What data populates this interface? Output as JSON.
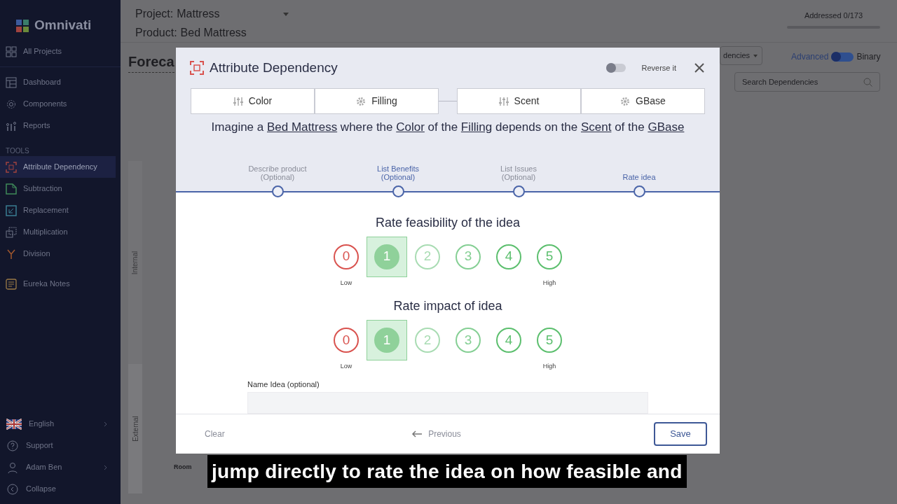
{
  "sidebar": {
    "logo": "Omnivati",
    "groups": [
      {
        "items": [
          {
            "label": "All Projects",
            "selected": false
          }
        ]
      },
      {
        "items": [
          {
            "label": "Dashboard",
            "selected": false
          },
          {
            "label": "Components",
            "selected": false
          },
          {
            "label": "Reports",
            "selected": false
          }
        ]
      },
      {
        "heading": "TOOLS",
        "items": [
          {
            "label": "Attribute Dependency",
            "selected": true
          },
          {
            "label": "Subtraction",
            "selected": false
          },
          {
            "label": "Replacement",
            "selected": false
          },
          {
            "label": "Multiplication",
            "selected": false
          },
          {
            "label": "Division",
            "selected": false
          }
        ]
      },
      {
        "items": [
          {
            "label": "Eureka Notes",
            "selected": false
          }
        ]
      }
    ],
    "bottom_items": [
      {
        "label": "English",
        "has_submenu": true
      },
      {
        "label": "Support",
        "has_submenu": false
      },
      {
        "label": "Adam Ben",
        "has_submenu": true
      },
      {
        "label": "Collapse",
        "has_submenu": false
      }
    ]
  },
  "header": {
    "project_label": "Project:",
    "project": "Mattress",
    "product_label": "Product:",
    "product": "Bed Mattress",
    "progress": {
      "label": "Addressed 0/173",
      "level": 0
    }
  },
  "page": {
    "title": "Foreca",
    "filter_dropdown": "dencies",
    "mode_toggle": {
      "left_label": "Advanced",
      "right_label": "Binary",
      "on": false
    },
    "search": {
      "placeholder": "Search Dependencies"
    },
    "side_labels": [
      "Internal",
      "External"
    ],
    "row_label": "Room"
  },
  "modal": {
    "title": "Attribute Dependency",
    "reverse_toggle": {
      "label": "Reverse it",
      "on": false
    },
    "attributes": [
      {
        "label": "Color",
        "kind": "attribute"
      },
      {
        "label": "Filling",
        "kind": "component"
      },
      {
        "label": "Scent",
        "kind": "attribute"
      },
      {
        "label": "GBase",
        "kind": "component"
      }
    ],
    "sentence": [
      {
        "text": "Imagine a ",
        "link": false
      },
      {
        "text": "Bed Mattress",
        "link": true
      },
      {
        "text": " where the ",
        "link": false
      },
      {
        "text": "Color",
        "link": true
      },
      {
        "text": " of the ",
        "link": false
      },
      {
        "text": "Filling",
        "link": true
      },
      {
        "text": " depends on the ",
        "link": false
      },
      {
        "text": "Scent",
        "link": true
      },
      {
        "text": " of the ",
        "link": false
      },
      {
        "text": "GBase",
        "link": true
      }
    ],
    "steps": [
      {
        "label": "Describe product",
        "sublabel": "(Optional)",
        "highlighted": false
      },
      {
        "label": "List Benefits",
        "sublabel": "(Optional)",
        "highlighted": true
      },
      {
        "label": "List Issues",
        "sublabel": "(Optional)",
        "highlighted": false
      },
      {
        "label": "Rate idea",
        "highlighted": true
      }
    ],
    "ratings": [
      {
        "title": "Rate feasibility of the idea",
        "low_label": "Low",
        "high_label": "High",
        "options": [
          {
            "label": "0",
            "color": "#d9534f",
            "selected": false
          },
          {
            "label": "1",
            "color": "#8fd19a",
            "selected": true
          },
          {
            "label": "2",
            "color": "#a9dcb3",
            "selected": false
          },
          {
            "label": "3",
            "color": "#85cf94",
            "selected": false
          },
          {
            "label": "4",
            "color": "#5cbf6e",
            "selected": false
          },
          {
            "label": "5",
            "color": "#5cbf6e",
            "selected": false
          }
        ]
      },
      {
        "title": "Rate impact of idea",
        "low_label": "Low",
        "high_label": "High",
        "options": [
          {
            "label": "0",
            "color": "#d9534f",
            "selected": false
          },
          {
            "label": "1",
            "color": "#8fd19a",
            "selected": true
          },
          {
            "label": "2",
            "color": "#a9dcb3",
            "selected": false
          },
          {
            "label": "3",
            "color": "#85cf94",
            "selected": false
          },
          {
            "label": "4",
            "color": "#5cbf6e",
            "selected": false
          },
          {
            "label": "5",
            "color": "#5cbf6e",
            "selected": false
          }
        ]
      }
    ],
    "name_field": {
      "label": "Name Idea (optional)"
    },
    "footer": {
      "clear": "Clear",
      "previous": "Previous",
      "save": "Save"
    }
  },
  "caption": "jump directly to rate the idea on how feasible and"
}
